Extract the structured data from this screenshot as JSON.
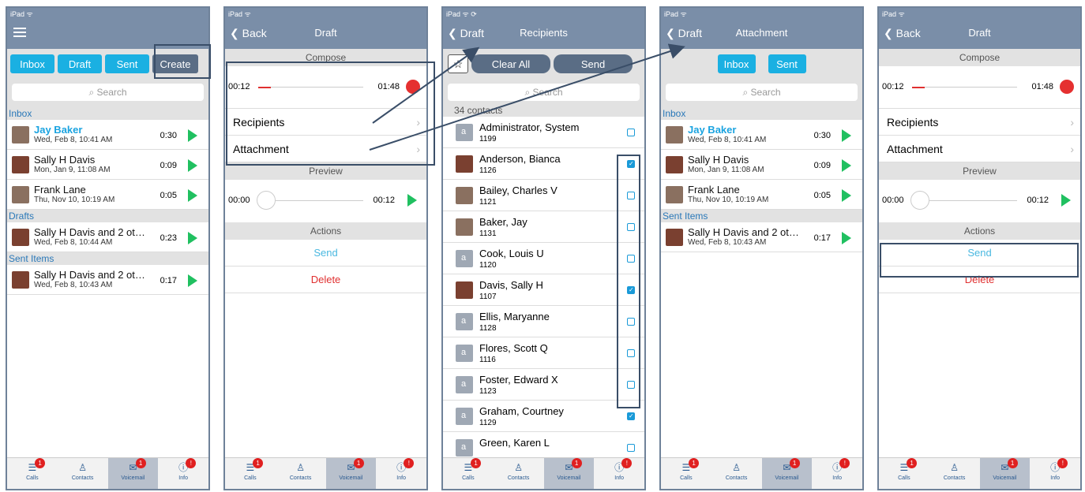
{
  "status": {
    "ipad": "iPad ᯤ",
    "ipad_sync": "iPad ᯤ ⟳"
  },
  "p1": {
    "buttons": [
      "Inbox",
      "Draft",
      "Sent",
      "Create"
    ],
    "search": "Search",
    "inbox_label": "Inbox",
    "inbox": [
      {
        "name": "Jay Baker",
        "date": "Wed, Feb 8, 10:41 AM",
        "dur": "0:30"
      },
      {
        "name": "Sally H Davis",
        "date": "Mon, Jan 9, 11:08 AM",
        "dur": "0:09"
      },
      {
        "name": "Frank Lane",
        "date": "Thu, Nov 10, 10:19 AM",
        "dur": "0:05"
      }
    ],
    "drafts_label": "Drafts",
    "drafts": [
      {
        "name": "Sally H Davis and 2 ot…",
        "date": "Wed, Feb 8, 10:44 AM",
        "dur": "0:23"
      }
    ],
    "sent_label": "Sent Items",
    "sent": [
      {
        "name": "Sally H Davis and 2 ot…",
        "date": "Wed, Feb 8, 10:43 AM",
        "dur": "0:17"
      }
    ]
  },
  "draft": {
    "back": "Back",
    "title": "Draft",
    "compose": "Compose",
    "t1": "00:12",
    "t2": "01:48",
    "recipients": "Recipients",
    "attachment": "Attachment",
    "preview": "Preview",
    "p1": "00:00",
    "p2": "00:12",
    "actions": "Actions",
    "send": "Send",
    "delete": "Delete"
  },
  "p3": {
    "back": "Draft",
    "title": "Recipients",
    "clear": "Clear All",
    "send": "Send",
    "search": "Search",
    "count": "34 contacts",
    "contacts": [
      {
        "name": "Administrator, System",
        "ext": "1199",
        "c": false
      },
      {
        "name": "Anderson, Bianca",
        "ext": "1126",
        "c": true
      },
      {
        "name": "Bailey, Charles V",
        "ext": "1121",
        "c": false
      },
      {
        "name": "Baker, Jay",
        "ext": "1131",
        "c": false
      },
      {
        "name": "Cook, Louis U",
        "ext": "1120",
        "c": false
      },
      {
        "name": "Davis, Sally H",
        "ext": "1107",
        "c": true
      },
      {
        "name": "Ellis, Maryanne",
        "ext": "1128",
        "c": false
      },
      {
        "name": "Flores, Scott Q",
        "ext": "1116",
        "c": false
      },
      {
        "name": "Foster, Edward X",
        "ext": "1123",
        "c": false
      },
      {
        "name": "Graham, Courtney",
        "ext": "1129",
        "c": true
      },
      {
        "name": "Green, Karen L",
        "ext": "",
        "c": false
      }
    ]
  },
  "p4": {
    "back": "Draft",
    "title": "Attachment",
    "buttons": [
      "Inbox",
      "Sent"
    ],
    "search": "Search",
    "inbox_label": "Inbox",
    "sent_label": "Sent Items",
    "inbox": [
      {
        "name": "Jay Baker",
        "date": "Wed, Feb 8, 10:41 AM",
        "dur": "0:30"
      },
      {
        "name": "Sally H Davis",
        "date": "Mon, Jan 9, 11:08 AM",
        "dur": "0:09"
      },
      {
        "name": "Frank Lane",
        "date": "Thu, Nov 10, 10:19 AM",
        "dur": "0:05"
      }
    ],
    "sent": [
      {
        "name": "Sally H Davis and 2 ot…",
        "date": "Wed, Feb 8, 10:43 AM",
        "dur": "0:17"
      }
    ]
  },
  "tabs": [
    {
      "label": "Calls",
      "icon": "calls-icon",
      "glyph": "☰",
      "badge": "1"
    },
    {
      "label": "Contacts",
      "icon": "contacts-icon",
      "glyph": "♙",
      "badge": ""
    },
    {
      "label": "Voicemail",
      "icon": "voicemail-icon",
      "glyph": "✉",
      "badge": "1"
    },
    {
      "label": "Info",
      "icon": "info-icon",
      "glyph": "ⓘ",
      "badge": "!"
    }
  ]
}
